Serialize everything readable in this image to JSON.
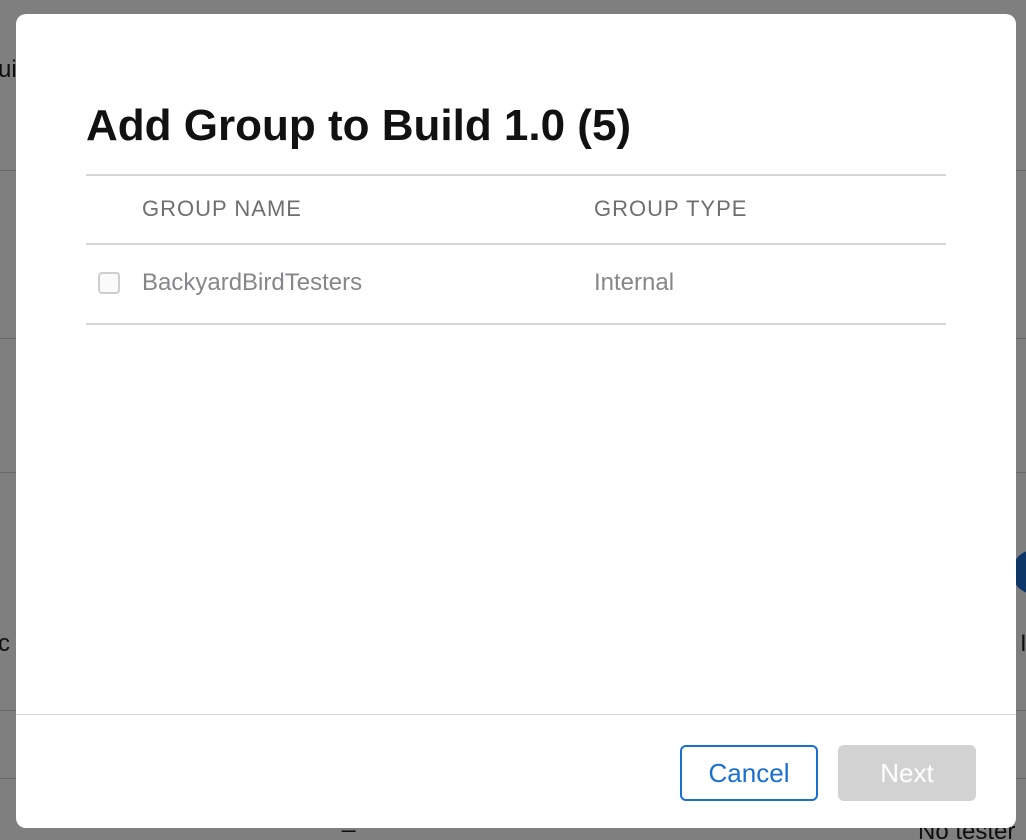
{
  "background": {
    "fragments": [
      "ui",
      "c",
      "I",
      "_",
      "No tester"
    ]
  },
  "modal": {
    "title": "Add Group to Build 1.0 (5)",
    "table": {
      "headers": {
        "group_name": "GROUP NAME",
        "group_type": "GROUP TYPE"
      },
      "rows": [
        {
          "name": "BackyardBirdTesters",
          "type": "Internal",
          "checked": false
        }
      ]
    },
    "footer": {
      "cancel_label": "Cancel",
      "next_label": "Next"
    }
  },
  "colors": {
    "accent": "#1a6fd0",
    "disabled_button": "#d2d2d2",
    "overlay": "rgba(0,0,0,0.5)"
  }
}
